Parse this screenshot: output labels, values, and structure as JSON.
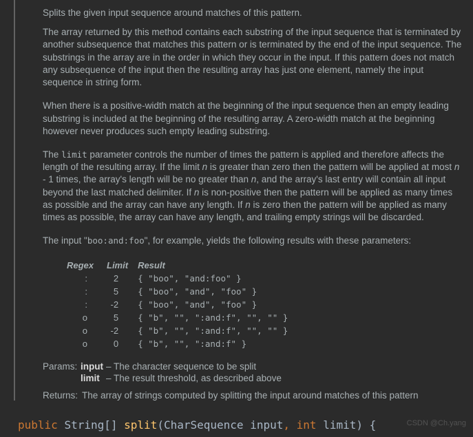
{
  "doc": {
    "summary": "Splits the given input sequence around matches of this pattern.",
    "para1": "The array returned by this method contains each substring of the input sequence that is terminated by another subsequence that matches this pattern or is terminated by the end of the input sequence. The substrings in the array are in the order in which they occur in the input. If this pattern does not match any subsequence of the input then the resulting array has just one element, namely the input sequence in string form.",
    "para2": "When there is a positive-width match at the beginning of the input sequence then an empty leading substring is included at the beginning of the resulting array. A zero-width match at the beginning however never produces such empty leading substring.",
    "limit_a": "The ",
    "limit_code": "limit",
    "limit_b": " parameter controls the number of times the pattern is applied and therefore affects the length of the resulting array. If the limit ",
    "n1": "n",
    "limit_c": " is greater than zero then the pattern will be applied at most ",
    "n2": "n",
    "limit_d": " - 1 times, the array's length will be no greater than ",
    "n3": "n",
    "limit_e": ", and the array's last entry will contain all input beyond the last matched delimiter. If ",
    "n4": "n",
    "limit_f": " is non-positive then the pattern will be applied as many times as possible and the array can have any length. If ",
    "n5": "n",
    "limit_g": " is zero then the pattern will be applied as many times as possible, the array can have any length, and trailing empty strings will be discarded.",
    "input_a": "The input \"",
    "input_code": "boo:and:foo",
    "input_b": "\", for example, yields the following results with these parameters:",
    "table": {
      "h1": "Regex",
      "h2": "Limit",
      "h3": "Result",
      "rows": [
        {
          "regex": ":",
          "limit": "2",
          "result": "{ \"boo\", \"and:foo\" }"
        },
        {
          "regex": ":",
          "limit": "5",
          "result": "{ \"boo\", \"and\", \"foo\" }"
        },
        {
          "regex": ":",
          "limit": "-2",
          "result": "{ \"boo\", \"and\", \"foo\" }"
        },
        {
          "regex": "o",
          "limit": "5",
          "result": "{ \"b\", \"\", \":and:f\", \"\", \"\" }"
        },
        {
          "regex": "o",
          "limit": "-2",
          "result": "{ \"b\", \"\", \":and:f\", \"\", \"\" }"
        },
        {
          "regex": "o",
          "limit": "0",
          "result": "{ \"b\", \"\", \":and:f\" }"
        }
      ]
    },
    "params_label": "Params:",
    "param1_name": "input",
    "param1_desc": " – The character sequence to be split",
    "param2_name": "limit",
    "param2_desc": " – The result threshold, as described above",
    "returns_label": "Returns:",
    "returns_desc": "The array of strings computed by splitting the input around matches of this pattern"
  },
  "code": {
    "public": "public",
    "ret": "String[]",
    "method": "split",
    "open": "(",
    "ptype1": "CharSequence",
    "pname1": "input",
    "comma": ",",
    "int": "int",
    "pname2": "limit",
    "close": ")",
    "brace": "{"
  },
  "watermark": "CSDN @Ch.yang"
}
